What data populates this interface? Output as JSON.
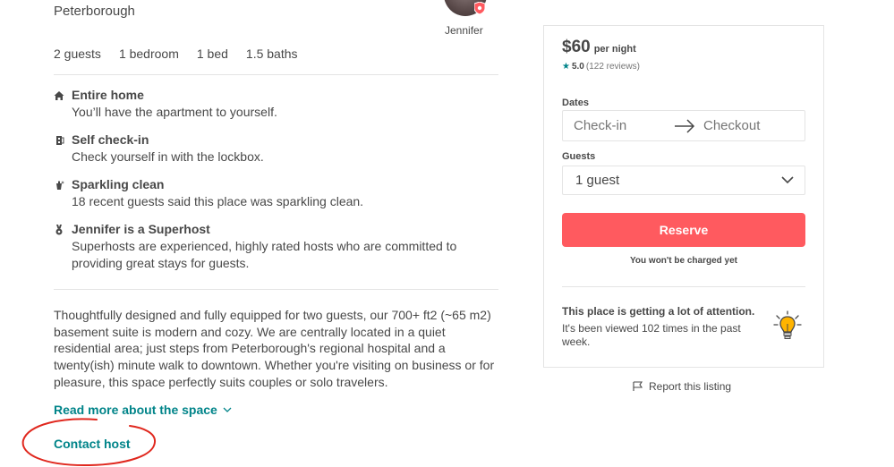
{
  "listing": {
    "location": "Peterborough",
    "host_name": "Jennifer",
    "stats": [
      "2 guests",
      "1 bedroom",
      "1 bed",
      "1.5 baths"
    ],
    "highlights": [
      {
        "icon": "home-icon",
        "title": "Entire home",
        "text": "You’ll have the apartment to yourself."
      },
      {
        "icon": "lockbox-icon",
        "title": "Self check-in",
        "text": "Check yourself in with the lockbox."
      },
      {
        "icon": "sparkle-icon",
        "title": "Sparkling clean",
        "text": "18 recent guests said this place was sparkling clean."
      },
      {
        "icon": "superhost-medal-icon",
        "title": "Jennifer is a Superhost",
        "text": "Superhosts are experienced, highly rated hosts who are committed to providing great stays for guests."
      }
    ],
    "description": "Thoughtfully designed and fully equipped for two guests, our 700+ ft2 (~65 m2) basement suite is modern and cozy. We are centrally located in a quiet residential area; just steps from Peterborough's regional hospital and a twenty(ish) minute walk to downtown. Whether you're visiting on business or for pleasure, this space perfectly suits couples or solo travelers.",
    "read_more": "Read more about the space",
    "contact_host": "Contact host"
  },
  "booking": {
    "price": "$60",
    "price_unit": "per night",
    "rating_star": "★",
    "rating_score": "5.0",
    "rating_count": "(122 reviews)",
    "dates_label": "Dates",
    "checkin_placeholder": "Check-in",
    "checkout_placeholder": "Checkout",
    "guests_label": "Guests",
    "guests_value": "1 guest",
    "reserve_label": "Reserve",
    "not_charged": "You won't be charged yet",
    "attention_title": "This place is getting a lot of attention.",
    "attention_text": "It's been viewed 102 times in the past week."
  },
  "report_label": "Report this listing",
  "colors": {
    "accent_teal": "#008489",
    "reserve_red": "#ff5a5f",
    "annotation_red": "#e0281e"
  }
}
